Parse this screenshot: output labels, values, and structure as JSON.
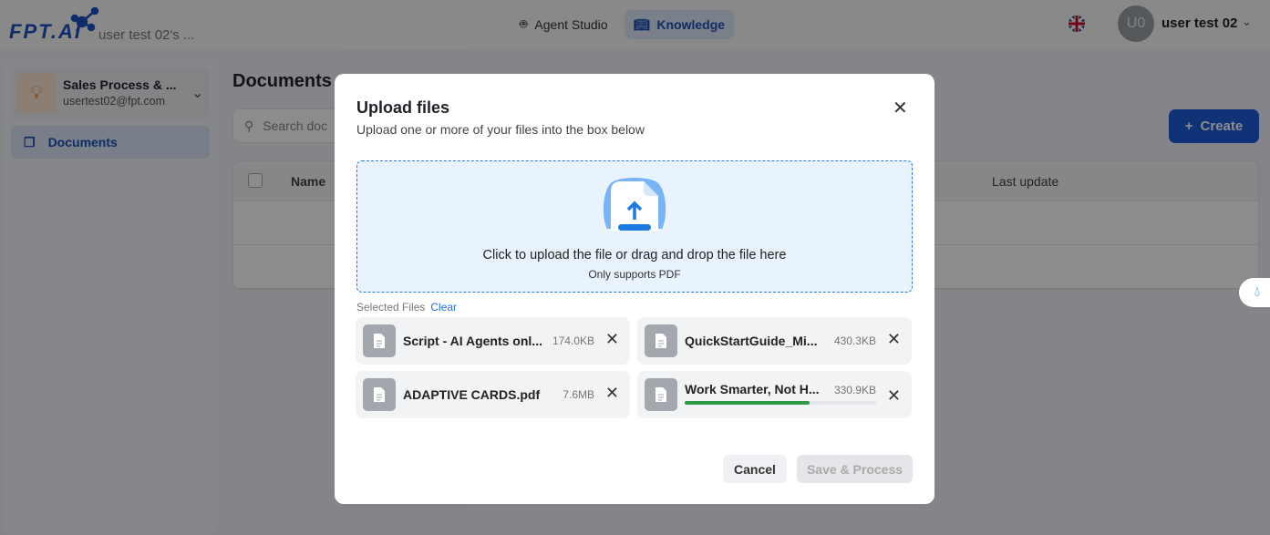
{
  "header": {
    "logo": "FPT.AI",
    "workspace": "user test 02's ...",
    "nav": [
      {
        "label": "Agent Studio",
        "icon": "robot-icon"
      },
      {
        "label": "Knowledge",
        "icon": "book-icon",
        "active": true
      }
    ],
    "language_icon": "uk-flag-icon",
    "avatar_initials": "U0",
    "user_name": "user test 02"
  },
  "sidebar": {
    "project_name": "Sales Process & ...",
    "project_email": "usertest02@fpt.com",
    "items": [
      {
        "label": "Documents",
        "icon": "documents-icon"
      }
    ]
  },
  "page": {
    "title": "Documents",
    "search_placeholder": "Search doc",
    "create_label": "Create",
    "columns": [
      "Name",
      "Last update"
    ]
  },
  "modal": {
    "title": "Upload files",
    "subtitle": "Upload one or more of your files into the box below",
    "dropzone_text": "Click to upload the file or drag and drop the file here",
    "dropzone_hint": "Only supports PDF",
    "selected_label": "Selected Files",
    "clear_label": "Clear",
    "files": [
      {
        "name": "Script - AI Agents onl...",
        "size": "174.0KB"
      },
      {
        "name": "QuickStartGuide_Mi...",
        "size": "430.3KB"
      },
      {
        "name": "ADAPTIVE CARDS.pdf",
        "size": "7.6MB"
      },
      {
        "name": "Work Smarter, Not H...",
        "size": "330.9KB",
        "progress_percent": 65
      }
    ],
    "cancel_label": "Cancel",
    "save_label": "Save & Process"
  },
  "colors": {
    "accent": "#1d5dd8",
    "progress": "#2e9a44",
    "dropzone_bg": "#e9f3fe"
  }
}
